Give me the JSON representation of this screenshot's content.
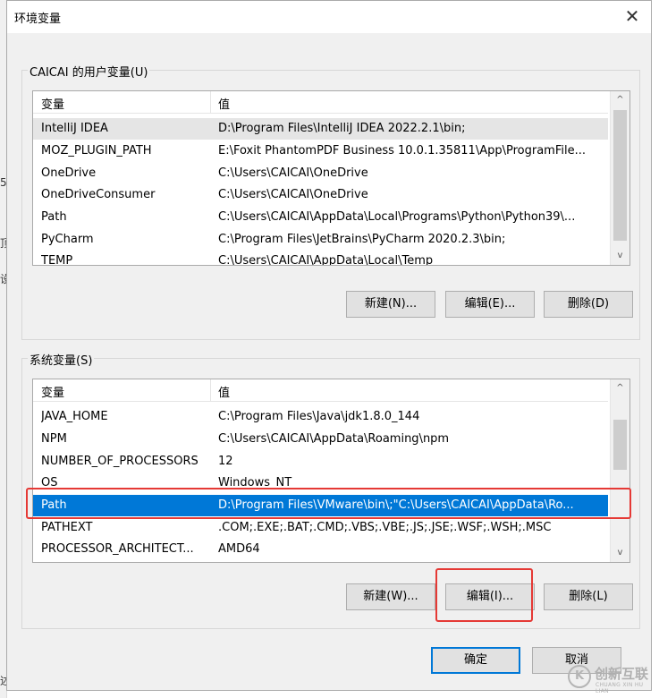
{
  "window": {
    "title": "环境变量",
    "close_glyph": "✕"
  },
  "background_chars": [
    "5",
    "顶",
    "设",
    "述"
  ],
  "user_vars": {
    "legend": "CAICAI 的用户变量(U)",
    "columns": [
      "变量",
      "值"
    ],
    "rows": [
      {
        "name": "IntelliJ IDEA",
        "value": "D:\\Program Files\\IntelliJ IDEA 2022.2.1\\bin;"
      },
      {
        "name": "MOZ_PLUGIN_PATH",
        "value": "E:\\Foxit PhantomPDF Business 10.0.1.35811\\App\\ProgramFile..."
      },
      {
        "name": "OneDrive",
        "value": "C:\\Users\\CAICAI\\OneDrive"
      },
      {
        "name": "OneDriveConsumer",
        "value": "C:\\Users\\CAICAI\\OneDrive"
      },
      {
        "name": "Path",
        "value": "C:\\Users\\CAICAI\\AppData\\Local\\Programs\\Python\\Python39\\..."
      },
      {
        "name": "PyCharm",
        "value": "C:\\Program Files\\JetBrains\\PyCharm 2020.2.3\\bin;"
      },
      {
        "name": "TEMP",
        "value": "C:\\Users\\CAICAI\\AppData\\Local\\Temp"
      }
    ],
    "buttons": {
      "new": "新建(N)...",
      "edit": "编辑(E)...",
      "delete": "删除(D)"
    }
  },
  "system_vars": {
    "legend": "系统变量(S)",
    "columns": [
      "变量",
      "值"
    ],
    "rows": [
      {
        "name": "JAVA_HOME",
        "value": "C:\\Program Files\\Java\\jdk1.8.0_144"
      },
      {
        "name": "NPM",
        "value": "C:\\Users\\CAICAI\\AppData\\Roaming\\npm"
      },
      {
        "name": "NUMBER_OF_PROCESSORS",
        "value": "12"
      },
      {
        "name": "OS",
        "value": "Windows_NT"
      },
      {
        "name": "Path",
        "value": "D:\\Program Files\\VMware\\bin\\;\"C:\\Users\\CAICAI\\AppData\\Ro..."
      },
      {
        "name": "PATHEXT",
        "value": ".COM;.EXE;.BAT;.CMD;.VBS;.VBE;.JS;.JSE;.WSF;.WSH;.MSC"
      },
      {
        "name": "PROCESSOR_ARCHITECT...",
        "value": "AMD64"
      }
    ],
    "selected_row": "Path",
    "buttons": {
      "new": "新建(W)...",
      "edit": "编辑(I)...",
      "delete": "删除(L)"
    }
  },
  "footer": {
    "ok": "确定",
    "cancel": "取消"
  },
  "watermark": {
    "text": "创新互联",
    "subtext": "CHUANG XIN HU LIAN",
    "logo": "K"
  },
  "colors": {
    "selection": "#0078d7",
    "highlight_box": "#e53935",
    "default_button_border": "#0078d7"
  },
  "icons": {
    "scroll_up": "^",
    "scroll_down": "v"
  }
}
